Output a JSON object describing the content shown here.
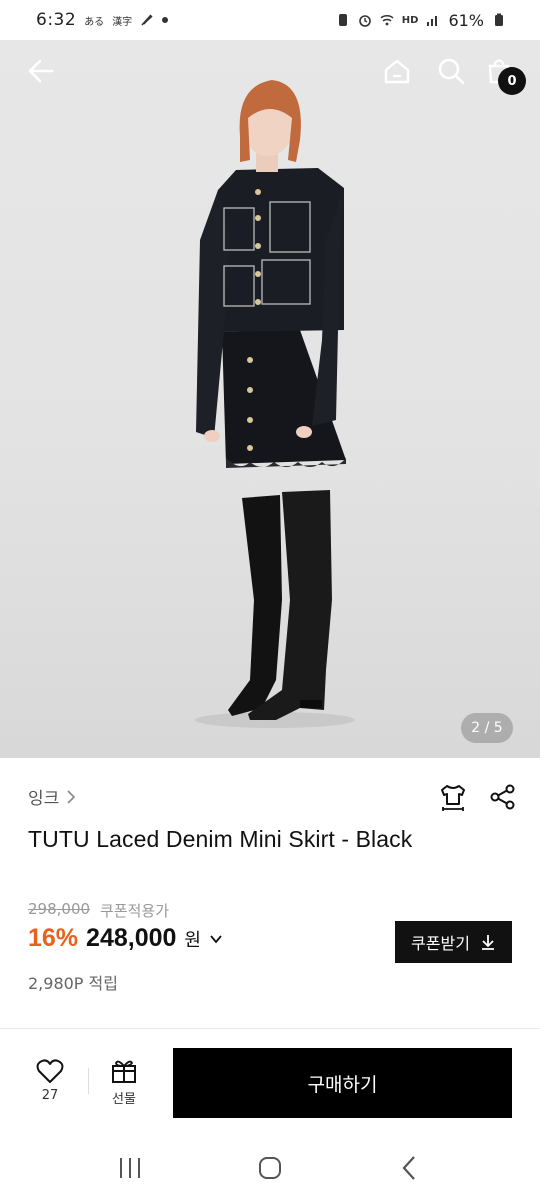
{
  "status_bar": {
    "time": "6:32",
    "left_small_1": "ある",
    "left_small_2": "漢字",
    "network": "HD",
    "battery": "61%"
  },
  "hero": {
    "page_indicator": "2 / 5",
    "cart_count": "0"
  },
  "product": {
    "brand": "잉크",
    "name": "TUTU Laced Denim Mini Skirt - Black",
    "original_price": "298,000",
    "coupon_price_label": "쿠폰적용가",
    "discount": "16%",
    "price": "248,000",
    "currency": "원",
    "coupon_button": "쿠폰받기",
    "points": "2,980P 적립"
  },
  "actions": {
    "like_count": "27",
    "gift_label": "선물",
    "buy_label": "구매하기"
  },
  "icons": {
    "back": "arrow-left-icon",
    "home": "home-icon",
    "search": "search-icon",
    "cart": "shopping-bag-icon",
    "fit": "shirt-size-icon",
    "share": "share-icon",
    "heart": "heart-icon",
    "gift": "gift-icon"
  },
  "colors": {
    "discount": "#e8611d",
    "primary_button": "#000000"
  }
}
